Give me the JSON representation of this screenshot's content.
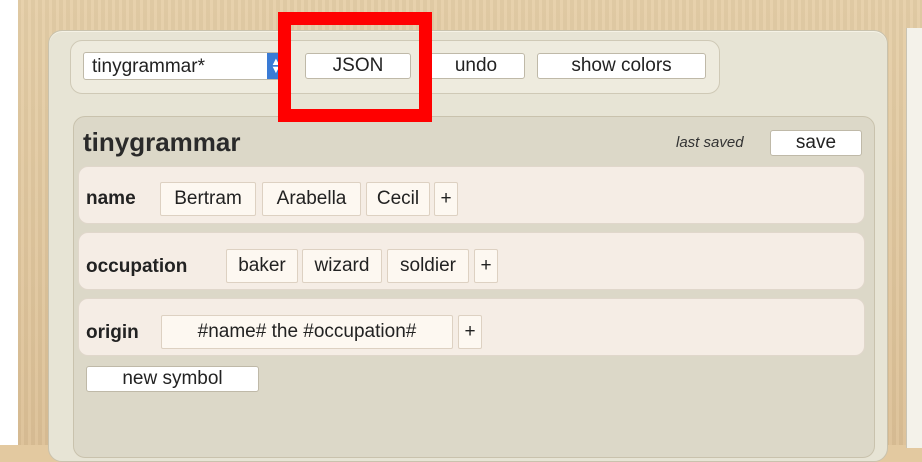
{
  "toolbar": {
    "grammar_select": "tinygrammar*",
    "json_label": "JSON",
    "undo_label": "undo",
    "show_colors_label": "show colors"
  },
  "grammar": {
    "title": "tinygrammar",
    "last_saved_label": "last saved",
    "save_label": "save",
    "new_symbol_label": "new symbol",
    "rows": [
      {
        "key": "name",
        "rules": [
          "Bertram",
          "Arabella",
          "Cecil"
        ],
        "add_label": "+"
      },
      {
        "key": "occupation",
        "rules": [
          "baker",
          "wizard",
          "soldier"
        ],
        "add_label": "+"
      },
      {
        "key": "origin",
        "rules": [
          "#name# the #occupation#"
        ],
        "add_label": "+"
      }
    ]
  },
  "highlight": {
    "color": "#ff0000",
    "target": "json-button"
  },
  "select_icon": "up-down-arrow-icon"
}
